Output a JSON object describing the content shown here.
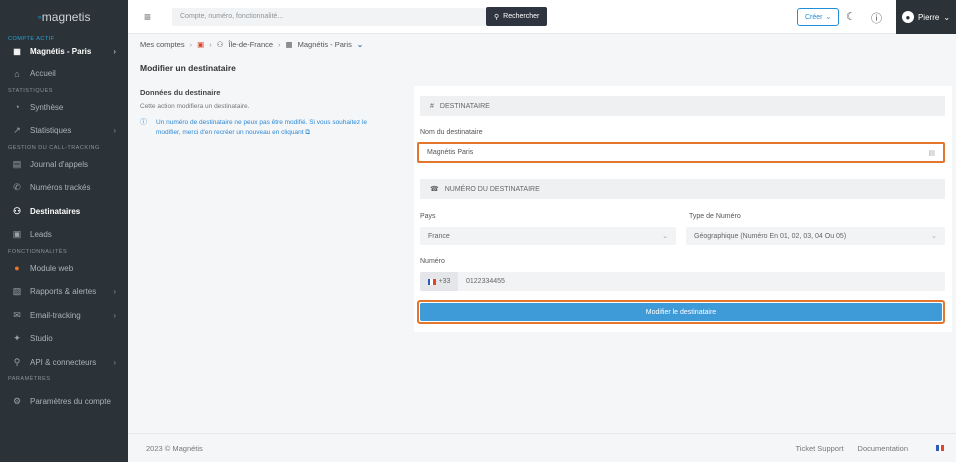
{
  "app": {
    "logo": "magnetis"
  },
  "sidebar": {
    "sections": {
      "active_account": "Compte actif",
      "stats": "Statistiques",
      "calltracking": "Gestion du call-tracking",
      "features": "Fonctionnalités",
      "settings": "Paramètres"
    },
    "account": "Magnétis - Paris",
    "items": {
      "home": "Accueil",
      "synthese": "Synthèse",
      "stats": "Statistiques",
      "journal": "Journal d'appels",
      "numeros": "Numéros trackés",
      "destinataires": "Destinataires",
      "leads": "Leads",
      "module": "Module web",
      "rapports": "Rapports & alertes",
      "email": "Email-tracking",
      "studio": "Studio",
      "api": "API & connecteurs",
      "params": "Paramètres du compte"
    }
  },
  "topbar": {
    "search_placeholder": "Compte, numéro, fonctionnalité...",
    "search_button": "Rechercher",
    "create_button": "Créer",
    "user_name": "Pierre"
  },
  "breadcrumb": {
    "root": "Mes comptes",
    "region": "Île-de-France",
    "account": "Magnétis - Paris"
  },
  "page": {
    "title": "Modifier un destinataire",
    "section_title": "Données du destinaire",
    "description": "Cette action modifiera un destinataire.",
    "info_line1": "Un numéro de destinataire ne peux pas être modifié. Si vous souhaitez le",
    "info_line2": "modifier, merci d'en recréer un nouveau en cliquant"
  },
  "form": {
    "section1": "Destinataire",
    "name_label": "Nom du destinataire",
    "name_value": "Magnétis Paris",
    "section2": "Numéro du destinataire",
    "country_label": "Pays",
    "country_value": "France",
    "type_label": "Type de Numéro",
    "type_value": "Géographique (Numéro En 01, 02, 03, 04 Ou 05)",
    "number_label": "Numéro",
    "number_prefix": "+33",
    "number_value": "0122334455",
    "submit": "Modifier le destinataire"
  },
  "footer": {
    "copyright": "2023 © Magnétis",
    "support": "Ticket Support",
    "docs": "Documentation"
  },
  "colors": {
    "sidebar_bg": "#2c3338",
    "accent": "#3f9ad8",
    "highlight": "#e4752d"
  }
}
